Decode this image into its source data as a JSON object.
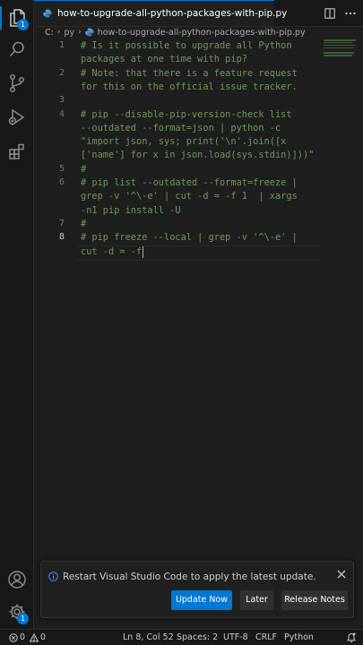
{
  "activity_bar": {
    "items": [
      {
        "name": "explorer",
        "icon": "files-icon",
        "badge": "1"
      },
      {
        "name": "search",
        "icon": "search-icon"
      },
      {
        "name": "source-control",
        "icon": "source-control-icon"
      },
      {
        "name": "run-debug",
        "icon": "run-debug-icon"
      },
      {
        "name": "extensions",
        "icon": "extensions-icon"
      }
    ],
    "bottom": [
      {
        "name": "accounts",
        "icon": "account-icon"
      },
      {
        "name": "manage",
        "icon": "gear-icon",
        "badge": "1"
      }
    ]
  },
  "tab": {
    "title": "how-to-upgrade-all-python-packages-with-pip.py",
    "dirty": true
  },
  "breadcrumb": {
    "drive": "C:",
    "folder": "py",
    "file": "how-to-upgrade-all-python-packages-with-pip.py"
  },
  "editor": {
    "comment_color": "#6a9955",
    "lines": [
      {
        "number": "1",
        "rows": [
          "# Is it possible to upgrade all Python",
          "packages at one time with pip?"
        ]
      },
      {
        "number": "2",
        "rows": [
          "# Note: that there is a feature request",
          "for this on the official issue tracker."
        ]
      },
      {
        "number": "3",
        "rows": [
          ""
        ]
      },
      {
        "number": "4",
        "rows": [
          "# pip --disable-pip-version-check list",
          "--outdated --format=json | python -c",
          "\"import json, sys; print('\\n'.join([x",
          "['name'] for x in json.load(sys.stdin)]))\""
        ]
      },
      {
        "number": "5",
        "rows": [
          "#"
        ]
      },
      {
        "number": "6",
        "rows": [
          "# pip list --outdated --format=freeze |",
          "grep -v '^\\-e' | cut -d = -f 1  | xargs",
          "-n1 pip install -U"
        ]
      },
      {
        "number": "7",
        "rows": [
          "#"
        ]
      },
      {
        "number": "8",
        "rows": [
          "# pip freeze --local | grep -v '^\\-e' |",
          "cut -d = -f"
        ]
      }
    ]
  },
  "notification": {
    "message": "Restart Visual Studio Code to apply the latest update.",
    "buttons": {
      "update": "Update Now",
      "later": "Later",
      "release_notes": "Release Notes"
    }
  },
  "status_bar": {
    "errors": "0",
    "warnings": "0",
    "position": "Ln 8, Col 52",
    "spaces": "Spaces: 2",
    "encoding": "UTF-8",
    "eol": "CRLF",
    "language": "Python"
  },
  "colors": {
    "accent": "#0078d4",
    "background": "#1e1e1e",
    "python_icon": "#4f9cd6"
  }
}
